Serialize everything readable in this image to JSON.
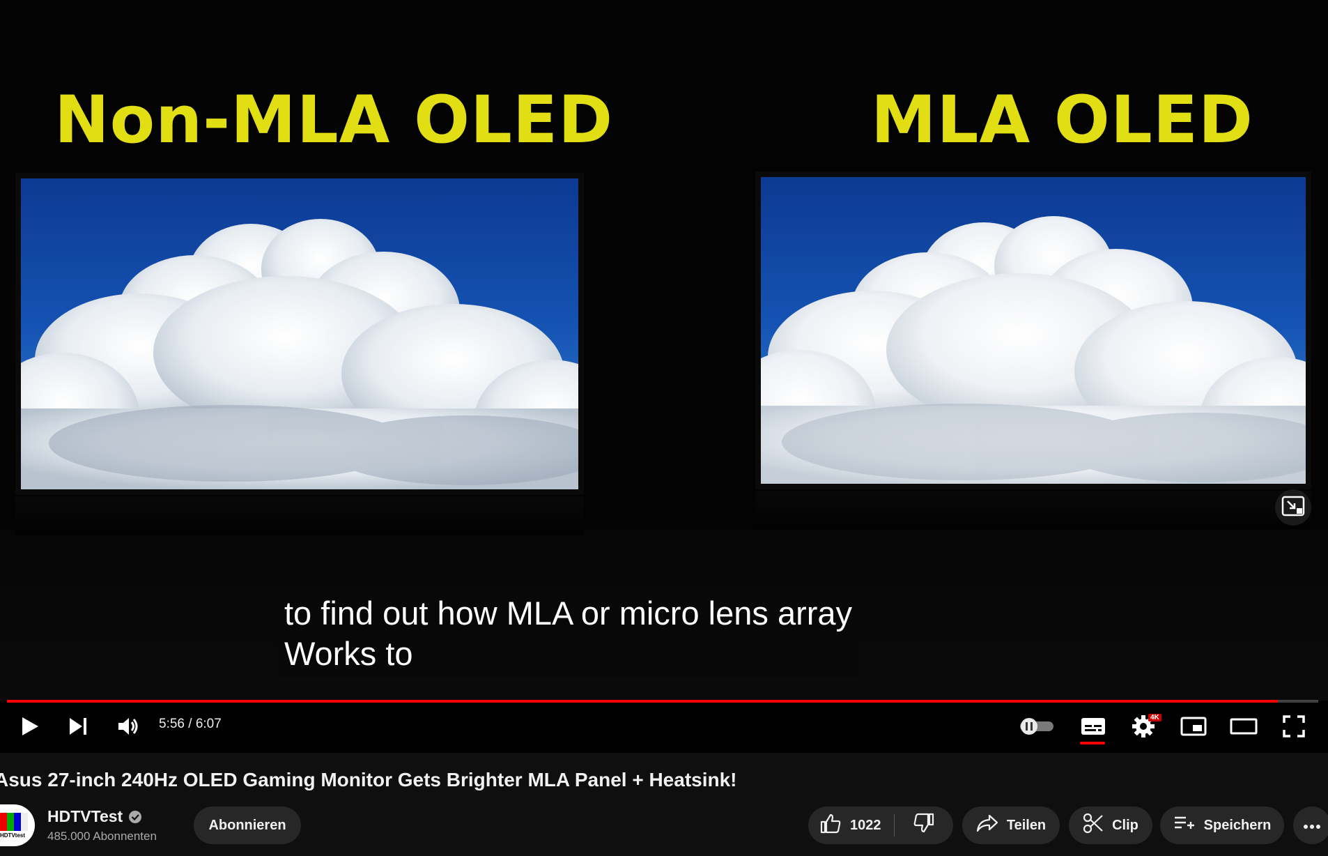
{
  "video": {
    "label_left": "Non-MLA OLED",
    "label_right": "MLA OLED",
    "caption_line1": "to find out how MLA or micro lens array",
    "caption_line2": "Works to"
  },
  "player": {
    "current_time": "5:56",
    "duration": "6:07",
    "time_display": "5:56 / 6:07",
    "progress_fraction": 0.969,
    "quality_badge": "4K",
    "icons": [
      "play-icon",
      "next-icon",
      "volume-icon",
      "autoplay-toggle-icon",
      "subtitles-icon",
      "settings-icon",
      "miniplayer-icon",
      "theater-icon",
      "fullscreen-icon",
      "exit-zoom-icon"
    ]
  },
  "meta": {
    "title": "Asus 27-inch 240Hz OLED Gaming Monitor Gets Brighter MLA Panel + Heatsink!",
    "channel_name": "HDTVTest",
    "subscriber_count": "485.000 Abonnenten",
    "avatar_text": "HDTVtest",
    "subscribe_label": "Abonnieren",
    "like_count": "1022",
    "share_label": "Teilen",
    "clip_label": "Clip",
    "save_label": "Speichern"
  },
  "colors": {
    "label_yellow": "#e2de14",
    "progress_red": "#ff0000",
    "background": "#0f0f0f",
    "pill": "#272727"
  }
}
